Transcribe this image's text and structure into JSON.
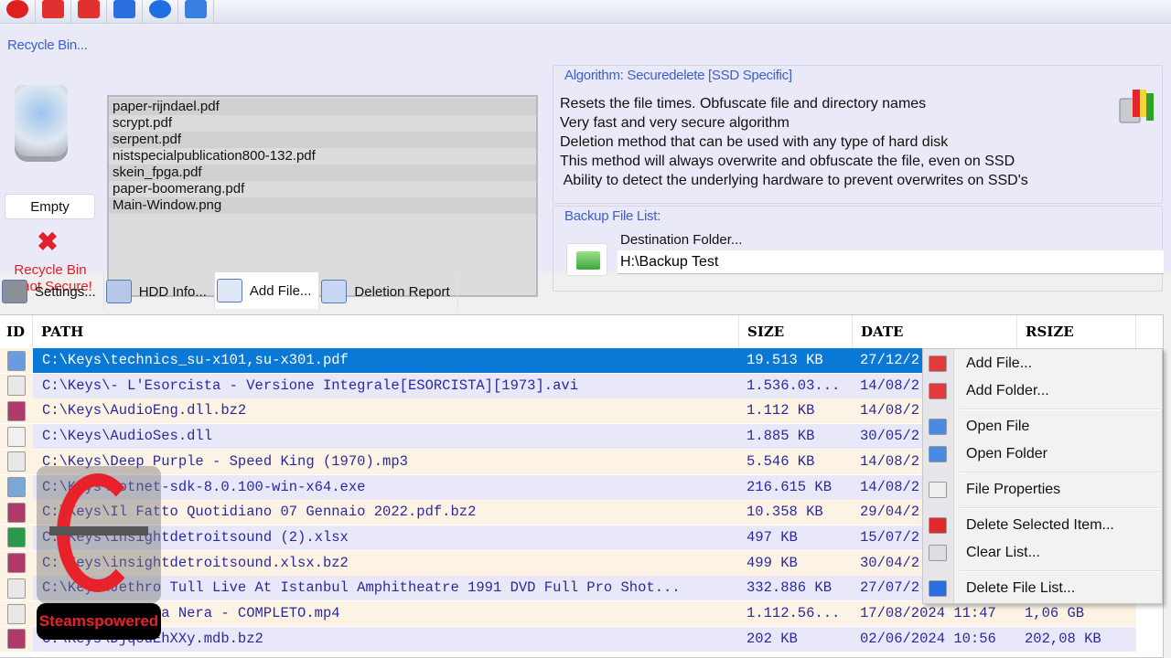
{
  "toolbar": {
    "buttons": [
      {
        "icon": "power-icon",
        "color": "#e02020"
      },
      {
        "icon": "folder-open-icon",
        "color": "#e03030"
      },
      {
        "icon": "folder-icon",
        "color": "#e03030"
      },
      {
        "icon": "database-icon",
        "color": "#2a6ee0"
      },
      {
        "icon": "help-icon",
        "color": "#1e6fe0"
      },
      {
        "icon": "footprint-icon",
        "color": "#3a7ee0"
      }
    ]
  },
  "recycle_bin": {
    "title": "Recycle Bin...",
    "empty_label": "Empty",
    "warning": [
      "Recycle Bin",
      "is not Secure!"
    ],
    "files": [
      "paper-rijndael.pdf",
      "scrypt.pdf",
      "serpent.pdf",
      "nistspecialpublication800-132.pdf",
      "skein_fpga.pdf",
      "paper-boomerang.pdf",
      "Main-Window.png"
    ]
  },
  "algorithm": {
    "title": "Algorithm: Securedelete [SSD Specific]",
    "lines": [
      "Resets the file times. Obfuscate file and directory names",
      "Very fast and very secure algorithm",
      "Deletion method that can be used with any type of hard disk",
      "This method will always overwrite and obfuscate the file, even on SSD",
      " Ability to detect the underlying hardware to prevent overwrites on SSD's"
    ]
  },
  "backup": {
    "title": "Backup File List:",
    "dest_label": "Destination Folder...",
    "dest_value": "H:\\Backup Test"
  },
  "tabs": [
    {
      "label": "Settings..."
    },
    {
      "label": "HDD Info..."
    },
    {
      "label": "Add File...",
      "active": true
    },
    {
      "label": "Deletion Report"
    }
  ],
  "table": {
    "headers": {
      "id": "ID",
      "path": "PATH",
      "size": "SIZE",
      "date": "DATE",
      "rsize": "RSIZE"
    },
    "rows": [
      {
        "type": "pdf",
        "path": "C:\\Keys\\technics_su-x101,su-x301.pdf",
        "size": "19.513 KB",
        "date": "27/12/2",
        "rsize": "",
        "selected": true
      },
      {
        "type": "media",
        "path": "C:\\Keys\\- L'Esorcista - Versione Integrale[ESORCISTA][1973].avi",
        "size": "1.536.03...",
        "date": "14/08/2",
        "rsize": ""
      },
      {
        "type": "archive",
        "path": "C:\\Keys\\AudioEng.dll.bz2",
        "size": "1.112 KB",
        "date": "14/08/2",
        "rsize": ""
      },
      {
        "type": "dll",
        "path": "C:\\Keys\\AudioSes.dll",
        "size": "1.885 KB",
        "date": "30/05/2",
        "rsize": ""
      },
      {
        "type": "media",
        "path": "C:\\Keys\\Deep Purple - Speed King (1970).mp3",
        "size": "5.546 KB",
        "date": "14/08/2",
        "rsize": ""
      },
      {
        "type": "exe",
        "path": "C:\\Keys\\dotnet-sdk-8.0.100-win-x64.exe",
        "size": "216.615 KB",
        "date": "14/08/2",
        "rsize": ""
      },
      {
        "type": "archive",
        "path": "C:\\Keys\\Il Fatto Quotidiano 07 Gennaio 2022.pdf.bz2",
        "size": "10.358 KB",
        "date": "29/04/2",
        "rsize": ""
      },
      {
        "type": "excel",
        "path": "C:\\Keys\\insightdetroitsound (2).xlsx",
        "size": "497 KB",
        "date": "15/07/2",
        "rsize": ""
      },
      {
        "type": "archive",
        "path": "C:\\Keys\\insightdetroitsound.xlsx.bz2",
        "size": "499 KB",
        "date": "30/04/2",
        "rsize": ""
      },
      {
        "type": "media",
        "path": "C:\\Keys\\Jethro Tull  Live At Istanbul Amphitheatre 1991  DVD Full Pro Shot...",
        "size": "332.886 KB",
        "date": "27/07/2",
        "rsize": ""
      },
      {
        "type": "media",
        "path": "C:\\Keys\\Freccia Nera - COMPLETO.mp4",
        "size": "1.112.56...",
        "date": "17/08/2024 11:47",
        "rsize": "1,06 GB"
      },
      {
        "type": "archive",
        "path": "C:\\Keys\\DjqouEhXXy.mdb.bz2",
        "size": "202 KB",
        "date": "02/06/2024 10:56",
        "rsize": "202,08 KB"
      }
    ]
  },
  "context_menu": {
    "items": [
      {
        "label": "Add File...",
        "icon": "folder-red-icon"
      },
      {
        "label": "Add Folder...",
        "icon": "folder-open-red-icon",
        "sep_after": true
      },
      {
        "label": "Open File",
        "icon": "open-file-icon"
      },
      {
        "label": "Open Folder",
        "icon": "open-folder-icon",
        "sep_after": true
      },
      {
        "label": "File Properties",
        "icon": "properties-icon",
        "sep_after": true
      },
      {
        "label": "Delete Selected Item...",
        "icon": "delete-x-icon"
      },
      {
        "label": "Clear List...",
        "icon": "clear-list-icon",
        "sep_after": true
      },
      {
        "label": "Delete File List...",
        "icon": "database-icon"
      }
    ]
  },
  "watermark": {
    "text": "Steamspowered"
  },
  "colors": {
    "selected_row": "#0a78d7",
    "row_even": "#fdf3e4",
    "row_odd": "#e8e8f8",
    "row_text": "#2a2aa0",
    "accent": "#3a5fd0",
    "danger": "#e0202a"
  }
}
